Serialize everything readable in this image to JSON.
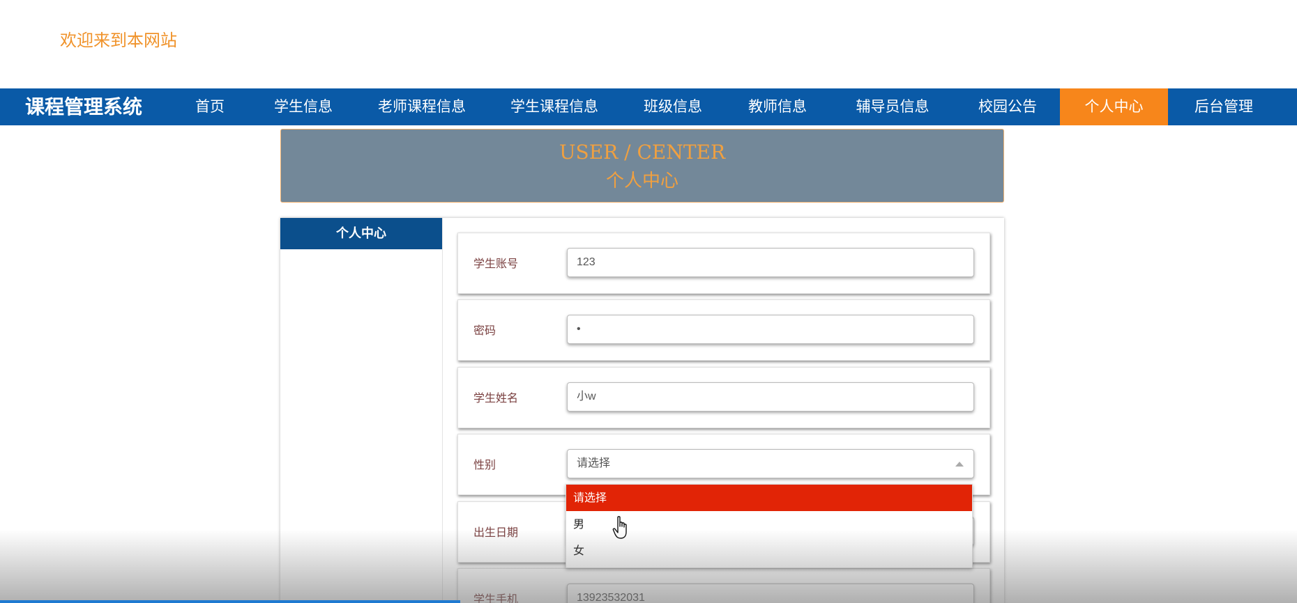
{
  "header": {
    "welcome": "欢迎来到本网站"
  },
  "nav": {
    "brand": "课程管理系统",
    "items": [
      "首页",
      "学生信息",
      "老师课程信息",
      "学生课程信息",
      "班级信息",
      "教师信息",
      "辅导员信息",
      "校园公告",
      "个人中心",
      "后台管理"
    ],
    "active_index": 8
  },
  "banner": {
    "en": "USER / CENTER",
    "zh": "个人中心"
  },
  "sidebar": {
    "title": "个人中心"
  },
  "form": {
    "account": {
      "label": "学生账号",
      "value": "123"
    },
    "password": {
      "label": "密码",
      "value": "•"
    },
    "name": {
      "label": "学生姓名",
      "value": "小w"
    },
    "gender": {
      "label": "性别",
      "value": "请选择",
      "options": [
        "请选择",
        "男",
        "女"
      ]
    },
    "birthday": {
      "label": "出生日期",
      "value": ""
    },
    "phone": {
      "label": "学生手机",
      "value": "13923532031"
    }
  },
  "colors": {
    "nav_bg": "#0a5aa7",
    "active_nav": "#f7861b",
    "accent_text": "#f0932b",
    "banner_bg": "#738899",
    "option_selected": "#e12406"
  },
  "icons": {
    "select_caret": "caret-up-icon",
    "pointer": "hand-pointer-icon"
  }
}
